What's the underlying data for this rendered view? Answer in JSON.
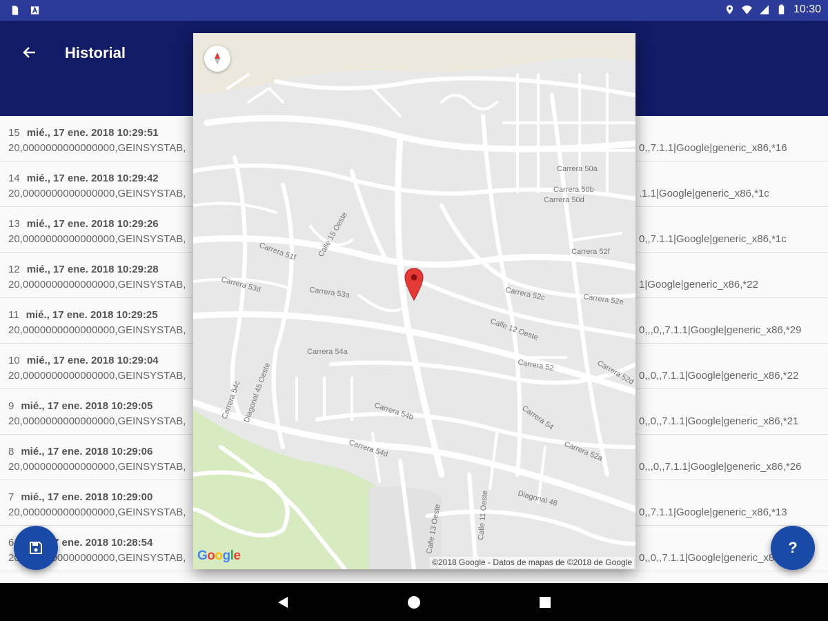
{
  "status_bar": {
    "time": "10:30",
    "icons_left": [
      "sd-card-icon",
      "app-notification-icon"
    ],
    "icons_right": [
      "location-icon",
      "wifi-icon",
      "signal-icon",
      "battery-icon"
    ]
  },
  "app_bar": {
    "title": "Historial",
    "back_icon": "arrow-back-icon",
    "color": "#111b66"
  },
  "history": {
    "rows": [
      {
        "index": "15",
        "timestamp": "mié., 17 ene. 2018 10:29:51",
        "data": "20,0000000000000000,GEINSYSTAB,",
        "tail": "0,,7.1.1|Google|generic_x86,*16"
      },
      {
        "index": "14",
        "timestamp": "mié., 17 ene. 2018 10:29:42",
        "data": "20,0000000000000000,GEINSYSTAB,",
        "tail": ".1.1|Google|generic_x86,*1c"
      },
      {
        "index": "13",
        "timestamp": "mié., 17 ene. 2018 10:29:26",
        "data": "20,0000000000000000,GEINSYSTAB,",
        "tail": "0,,7.1.1|Google|generic_x86,*1c"
      },
      {
        "index": "12",
        "timestamp": "mié., 17 ene. 2018 10:29:28",
        "data": "20,0000000000000000,GEINSYSTAB,",
        "tail": "1|Google|generic_x86,*22"
      },
      {
        "index": "11",
        "timestamp": "mié., 17 ene. 2018 10:29:25",
        "data": "20,0000000000000000,GEINSYSTAB,",
        "tail": "0,,,0,,7.1.1|Google|generic_x86,*29"
      },
      {
        "index": "10",
        "timestamp": "mié., 17 ene. 2018 10:29:04",
        "data": "20,0000000000000000,GEINSYSTAB,",
        "tail": "0,,0,,7.1.1|Google|generic_x86,*22"
      },
      {
        "index": "9",
        "timestamp": "mié., 17 ene. 2018 10:29:05",
        "data": "20,0000000000000000,GEINSYSTAB,",
        "tail": "0,,0,,7.1.1|Google|generic_x86,*21"
      },
      {
        "index": "8",
        "timestamp": "mié., 17 ene. 2018 10:29:06",
        "data": "20,0000000000000000,GEINSYSTAB,",
        "tail": "0,,,0,,7.1.1|Google|generic_x86,*26"
      },
      {
        "index": "7",
        "timestamp": "mié., 17 ene. 2018 10:29:00",
        "data": "20,0000000000000000,GEINSYSTAB,",
        "tail": "0,,7.1.1|Google|generic_x86,*13"
      },
      {
        "index": "6",
        "timestamp": "mié., 17 ene. 2018 10:28:54",
        "data": "20,0000000000000000,GEINSYSTAB,",
        "tail": "0,,0,,7.1.1|Google|generic_x86,*21"
      }
    ]
  },
  "map": {
    "logo": "Google",
    "credits": "©2018 Google - Datos de mapas de ©2018 de Google",
    "compass_icon": "compass-icon",
    "marker_icon": "map-pin-icon",
    "street_labels": [
      "Carrera 54a",
      "Carrera 54b",
      "Carrera 54d",
      "Carrera 54",
      "Carrera 52a",
      "Carrera 52",
      "Carrera 52d",
      "Carrera 50d",
      "Carrera 50b",
      "Carrera 50a",
      "Carrera 52f",
      "Carrera 52c",
      "Carrera 52e",
      "Carrera 53a",
      "Calle 13 Oeste",
      "Calle 11 Oeste",
      "Calle 12 Oeste",
      "Diagonal 48",
      "Diagonal 45 Oeste",
      "Carrera 54c",
      "Carrera 51f",
      "Carrera 53d",
      "Calle 15 Oeste"
    ]
  },
  "fabs": {
    "save_icon": "save-icon",
    "help_label": "?",
    "color": "#1a4aa8"
  },
  "nav_bar": {
    "icons": [
      "nav-back-icon",
      "nav-home-icon",
      "nav-recents-icon"
    ]
  }
}
